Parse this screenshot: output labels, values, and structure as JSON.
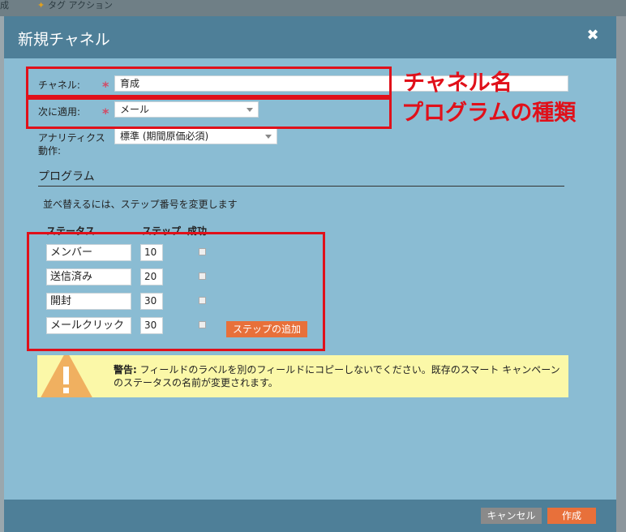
{
  "background": {
    "menu_left": "成",
    "menu_tag_action": "タグ アクション"
  },
  "dialog": {
    "title": "新規チャネル",
    "close_glyph": "✖"
  },
  "form": {
    "channel_label": "チャネル:",
    "channel_value": "育成",
    "apply_label": "次に適用:",
    "apply_value": "メール",
    "analytics_label_1": "アナリティクス",
    "analytics_label_2": "動作:",
    "analytics_value": "標準 (期間原価必須)",
    "required_mark": "*"
  },
  "program": {
    "section_title": "プログラム",
    "hint": "並べ替えるには、ステップ番号を変更します",
    "col_status": "ステータス",
    "col_step": "ステップ",
    "col_success": "成功",
    "rows": [
      {
        "status": "メンバー",
        "step": "10",
        "success": false
      },
      {
        "status": "送信済み",
        "step": "20",
        "success": false
      },
      {
        "status": "開封",
        "step": "30",
        "success": false
      },
      {
        "status": "メールクリック",
        "step": "30",
        "success": false
      }
    ],
    "add_step_label": "ステップの追加"
  },
  "warning": {
    "bold": "警告:",
    "text": " フィールドのラベルを別のフィールドにコピーしないでください。既存のスマート キャンペーンのステータスの名前が変更されます。"
  },
  "footer": {
    "cancel_label": "キャンセル",
    "create_label": "作成"
  },
  "annotations": {
    "channel_name": "チャネル名",
    "program_type": "プログラムの種類"
  },
  "colors": {
    "header": "#4e7f98",
    "dialog_bg": "#8abcd3",
    "accent_orange": "#e8703a",
    "annotation_red": "#e0101a",
    "warning_bg": "#fbf8a8"
  }
}
